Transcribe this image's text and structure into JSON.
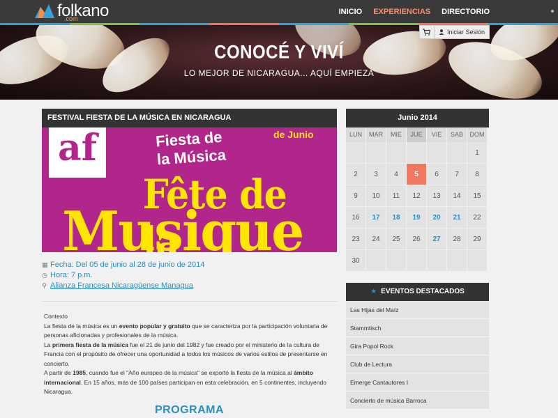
{
  "brand": {
    "name": "folkano",
    "sub": ".com"
  },
  "nav": {
    "items": [
      {
        "label": "INICIO"
      },
      {
        "label": "EXPERIENCIAS"
      },
      {
        "label": "DIRECTORIO"
      }
    ]
  },
  "hero": {
    "title": "CONOCÉ Y VIVÍ",
    "subtitle": "LO MEJOR DE NICARAGUA... AQUÍ EMPIEZA",
    "login_label": "Iniciar Sesión"
  },
  "event": {
    "title": "FESTIVAL FIESTA DE LA MÚSICA EN NICARAGUA",
    "poster": {
      "logo": "af",
      "top_line1": "Fiesta de",
      "top_line2": "la Música",
      "date_text": "de Junio",
      "big1": "Fête de la",
      "big2": "Musique"
    },
    "date": "Fecha: Del 05 de junio al 28 de junio de 2014",
    "time": "Hora: 7 p.m.",
    "venue": "Alianza Francesa Nicaragüense Managua",
    "context_title": "Contexto",
    "p1_a": "La fiesta de la música es un ",
    "p1_b": "evento popular y gratuito",
    "p1_c": " que se caracteriza por la participación voluntaria de personas aficionadas y profesionales de la música.",
    "p2_a": "La ",
    "p2_b": "primera fiesta de la música",
    "p2_c": " fue el 21 de junio del 1982 y fue creado por el ministerio de la cultura de Francia con el propósito de ofrecer una oportunidad a todos los músicos de varios estilos de presentarse en concierto.",
    "p3_a": "A partir de ",
    "p3_b": "1985",
    "p3_c": ", cuando fue el \"Año europeo de la música\" se exportó la fiesta de la música al ",
    "p3_d": "ámbito internacional",
    "p3_e": ". En 15 años, más de 100 países participan en esta celebración, en 5 continentes, incluyendo Nicaragua.",
    "programa": "PROGRAMA"
  },
  "calendar": {
    "title": "Junio 2014",
    "days": [
      "LUN",
      "MAR",
      "MIE",
      "JUE",
      "VIE",
      "SAB",
      "DOM"
    ],
    "cells": [
      "",
      "",
      "",
      "",
      "",
      "",
      "1",
      "2",
      "3",
      "4",
      "5",
      "6",
      "7",
      "8",
      "9",
      "10",
      "11",
      "12",
      "13",
      "14",
      "15",
      "16",
      "17",
      "18",
      "19",
      "20",
      "21",
      "22",
      "23",
      "24",
      "25",
      "26",
      "27",
      "28",
      "29",
      "30",
      "",
      "",
      "",
      "",
      "",
      ""
    ],
    "highlighted": [
      "17",
      "18",
      "19",
      "20",
      "21",
      "27"
    ],
    "today": "5"
  },
  "featured": {
    "title": "EVENTOS DESTACADOS",
    "items": [
      "Las Hijas del Maíz",
      "Stammtisch",
      "Gira Popol Rock",
      "Club de Lectura",
      "Emerge Cantautores I",
      "Concierto de música Barroca"
    ]
  },
  "colors": {
    "accent": "#2a8ec5",
    "nav_active": "#ff8e6b",
    "today": "#f07860",
    "dark_header": "#333333",
    "poster_bg": "#b1268a",
    "poster_text": "#ffe600"
  }
}
